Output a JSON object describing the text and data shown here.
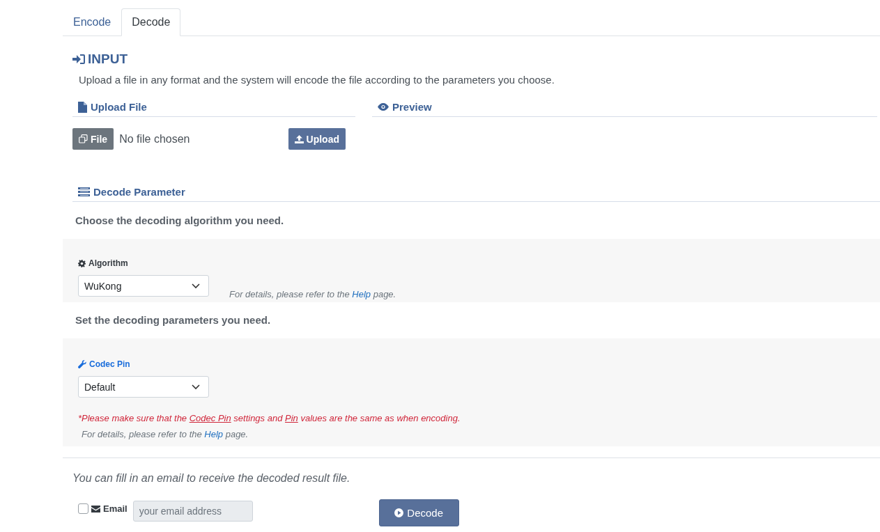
{
  "tabs": [
    {
      "label": "Encode",
      "selected": false
    },
    {
      "label": "Decode",
      "selected": true
    }
  ],
  "input": {
    "title": "INPUT",
    "description": "Upload a file in any format and the system will encode the file according to the parameters you choose.",
    "upload": {
      "title": "Upload File",
      "file_button": "File",
      "file_status": "No file chosen",
      "upload_button": "Upload"
    },
    "preview": {
      "title": "Preview"
    }
  },
  "decode_parameter": {
    "title": "Decode Parameter",
    "algorithm_intro": "Choose the decoding algorithm you need.",
    "algorithm": {
      "label": "Algorithm",
      "value": "WuKong",
      "help": {
        "before": "For details, please refer to the ",
        "link": "Help",
        "after": " page."
      }
    },
    "parameters_intro": "Set the decoding parameters you need.",
    "codec_pin": {
      "label": "Codec Pin",
      "value": "Default",
      "warning": [
        {
          "text": "*Please make sure that the ",
          "underline": false
        },
        {
          "text": "Codec Pin",
          "underline": true
        },
        {
          "text": " settings and ",
          "underline": false
        },
        {
          "text": "Pin",
          "underline": true
        },
        {
          "text": " values are the same as when encoding.",
          "underline": false
        }
      ],
      "help": {
        "before": "For details, please refer to the ",
        "link": "Help",
        "after": " page."
      }
    }
  },
  "email": {
    "intro": "You can fill in an email to receive the decoded result file.",
    "checked": false,
    "label": "Email",
    "placeholder": "your email address",
    "submit": "Decode"
  }
}
